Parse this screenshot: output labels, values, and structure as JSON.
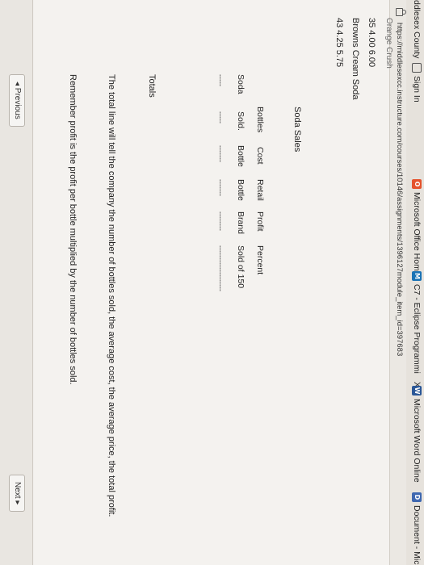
{
  "bookmarks": [
    {
      "label": "ddlesex County",
      "icon": "none"
    },
    {
      "label": "Sign In",
      "icon": "box-icon"
    },
    {
      "label": "Microsoft Office Home",
      "icon": "office-icon"
    },
    {
      "label": "C7 - Eclipse Programmi",
      "icon": "m-icon"
    },
    {
      "label": "Microsoft Word Online",
      "icon": "word-icon"
    },
    {
      "label": "Document - Micr",
      "icon": "doc-icon"
    }
  ],
  "tab_close": "X",
  "url": "https://middlesexcc.instructure.com/courses/10146/assignments/1396127module_item_id=397683",
  "content": {
    "cut_line": "Orange Crush",
    "line1": "35 4.00 6.00",
    "line2": "Browns Cream Soda",
    "line3": "43 4.25 5.75",
    "table_title": "Soda Sales",
    "header_row1": [
      "Bottles",
      "Cost",
      "Retail",
      "Profit",
      "Percent"
    ],
    "header_row2": [
      "Soda",
      "Sold.",
      "Bottle",
      "Bottle",
      "Brand",
      "Sold of 150"
    ],
    "dash_row": [
      "-----",
      "-----",
      "-------",
      "-------",
      "--------",
      "-------------------"
    ],
    "totals_label": "Totals",
    "para1": "The total line will tell the company the number of bottles sold, the average cost, the average price, the total profit.",
    "para2": "Remember profit is the profit per bottle multiplied by the number of bottles sold."
  },
  "nav": {
    "previous": "◂ Previous",
    "next": "Next ▸"
  }
}
